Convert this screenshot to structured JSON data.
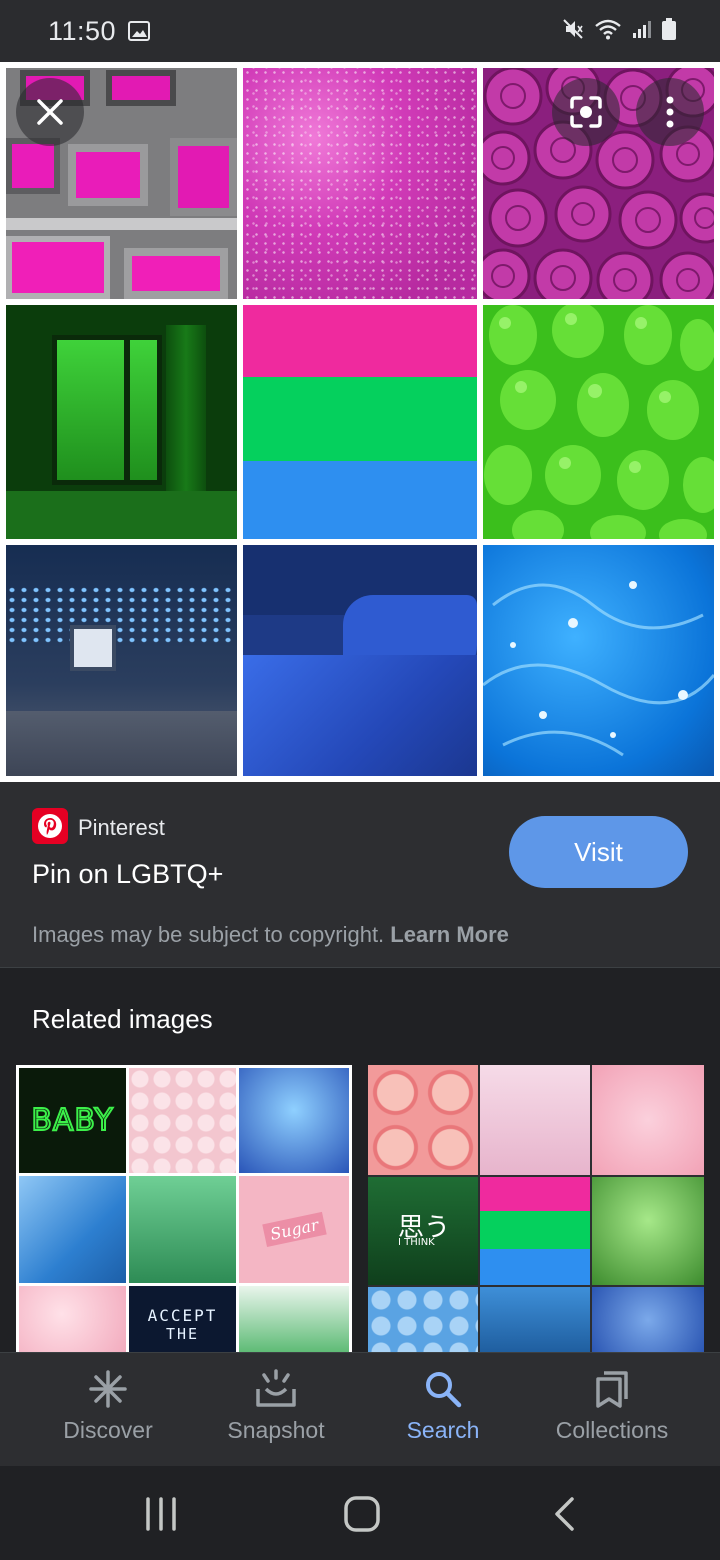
{
  "status_bar": {
    "time": "11:50"
  },
  "result": {
    "source": "Pinterest",
    "title": "Pin on LGBTQ+",
    "visit_label": "Visit",
    "copyright_text": "Images may be subject to copyright.",
    "learn_more": "Learn More"
  },
  "related": {
    "heading": "Related images",
    "tile_text": {
      "baby": "BABY",
      "sugar": "Sugar",
      "accept": "ACCEPT",
      "the": "THE",
      "omou": "思う",
      "think": "I THINK"
    }
  },
  "bottom_nav": {
    "items": [
      {
        "label": "Discover",
        "icon": "asterisk-icon"
      },
      {
        "label": "Snapshot",
        "icon": "snapshot-icon"
      },
      {
        "label": "Search",
        "icon": "search-icon",
        "active": true
      },
      {
        "label": "Collections",
        "icon": "bookmarks-icon"
      }
    ]
  },
  "colors": {
    "accent": "#8ab4f8",
    "visit_button": "#5e97e8",
    "background": "#202124",
    "card": "#2d2e31",
    "magenta": "#ef2a9e",
    "green": "#05d05d",
    "blue": "#2e8ff0"
  }
}
